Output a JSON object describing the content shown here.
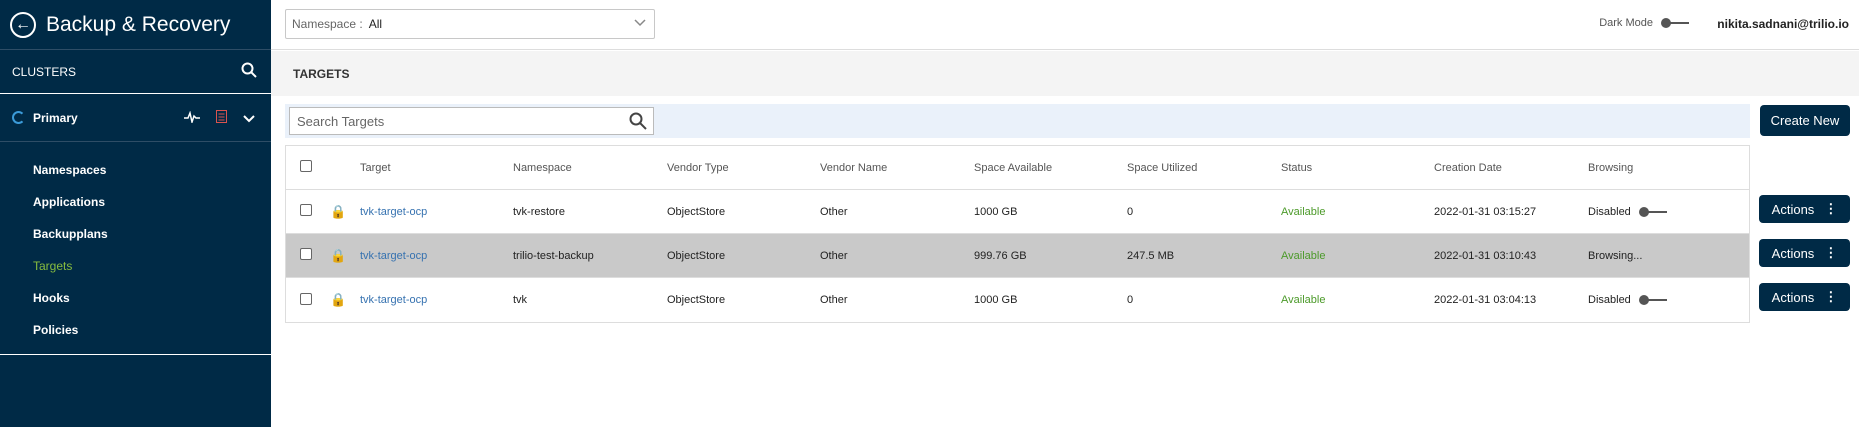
{
  "brand": {
    "title": "Backup & Recovery"
  },
  "sidebar": {
    "clusters_label": "CLUSTERS",
    "cluster": {
      "name": "Primary"
    },
    "items": [
      {
        "label": "Namespaces"
      },
      {
        "label": "Applications"
      },
      {
        "label": "Backupplans"
      },
      {
        "label": "Targets"
      },
      {
        "label": "Hooks"
      },
      {
        "label": "Policies"
      }
    ]
  },
  "topbar": {
    "namespace_label": "Namespace :",
    "namespace_value": "All",
    "dark_mode_label": "Dark Mode",
    "user": "nikita.sadnani@trilio.io"
  },
  "page": {
    "title": "TARGETS",
    "search_placeholder": "Search Targets",
    "create_label": "Create New",
    "actions_label": "Actions"
  },
  "table": {
    "columns": [
      "Target",
      "Namespace",
      "Vendor Type",
      "Vendor Name",
      "Space Available",
      "Space Utilized",
      "Status",
      "Creation Date",
      "Browsing"
    ],
    "rows": [
      {
        "target": "tvk-target-ocp",
        "namespace": "tvk-restore",
        "vendor_type": "ObjectStore",
        "vendor_name": "Other",
        "space_available": "1000 GB",
        "space_utilized": "0",
        "status": "Available",
        "creation_date": "2022-01-31 03:15:27",
        "browsing": "Disabled"
      },
      {
        "target": "tvk-target-ocp",
        "namespace": "trilio-test-backup",
        "vendor_type": "ObjectStore",
        "vendor_name": "Other",
        "space_available": "999.76 GB",
        "space_utilized": "247.5 MB",
        "status": "Available",
        "creation_date": "2022-01-31 03:10:43",
        "browsing": "Browsing..."
      },
      {
        "target": "tvk-target-ocp",
        "namespace": "tvk",
        "vendor_type": "ObjectStore",
        "vendor_name": "Other",
        "space_available": "1000 GB",
        "space_utilized": "0",
        "status": "Available",
        "creation_date": "2022-01-31 03:04:13",
        "browsing": "Disabled"
      }
    ]
  },
  "colors": {
    "navy": "#002a46",
    "accent_green": "#86bc3f",
    "status_green": "#4c9a2a",
    "link_blue": "#3672b0"
  },
  "icons": [
    "back-arrow-icon",
    "search-icon",
    "pulse-icon",
    "document-icon",
    "chevron-down-icon",
    "lock-icon",
    "kebab-icon"
  ]
}
